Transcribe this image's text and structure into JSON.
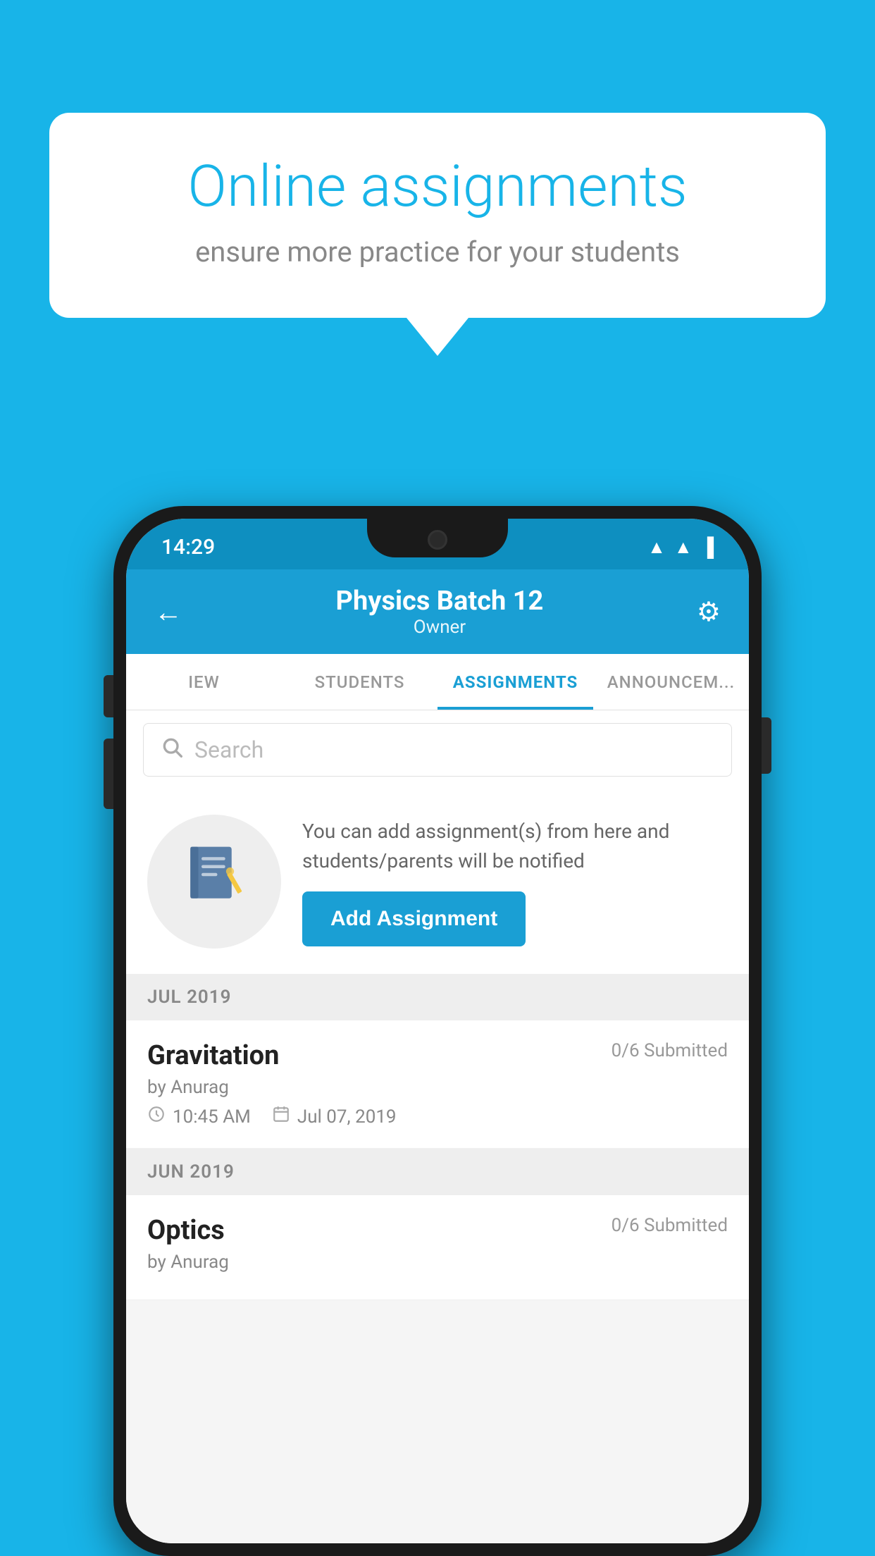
{
  "background_color": "#18b4e8",
  "speech_bubble": {
    "title": "Online assignments",
    "subtitle": "ensure more practice for your students"
  },
  "phone": {
    "status_bar": {
      "time": "14:29",
      "icons": [
        "wifi",
        "signal",
        "battery"
      ]
    },
    "header": {
      "title": "Physics Batch 12",
      "subtitle": "Owner",
      "back_label": "←",
      "settings_label": "⚙"
    },
    "tabs": [
      {
        "label": "IEW",
        "active": false
      },
      {
        "label": "STUDENTS",
        "active": false
      },
      {
        "label": "ASSIGNMENTS",
        "active": true
      },
      {
        "label": "ANNOUNCEM...",
        "active": false
      }
    ],
    "search": {
      "placeholder": "Search"
    },
    "promo": {
      "text": "You can add assignment(s) from here and students/parents will be notified",
      "button_label": "Add Assignment"
    },
    "sections": [
      {
        "month": "JUL 2019",
        "assignments": [
          {
            "title": "Gravitation",
            "submitted": "0/6 Submitted",
            "author": "by Anurag",
            "time": "10:45 AM",
            "date": "Jul 07, 2019"
          }
        ]
      },
      {
        "month": "JUN 2019",
        "assignments": [
          {
            "title": "Optics",
            "submitted": "0/6 Submitted",
            "author": "by Anurag",
            "time": "",
            "date": ""
          }
        ]
      }
    ]
  }
}
